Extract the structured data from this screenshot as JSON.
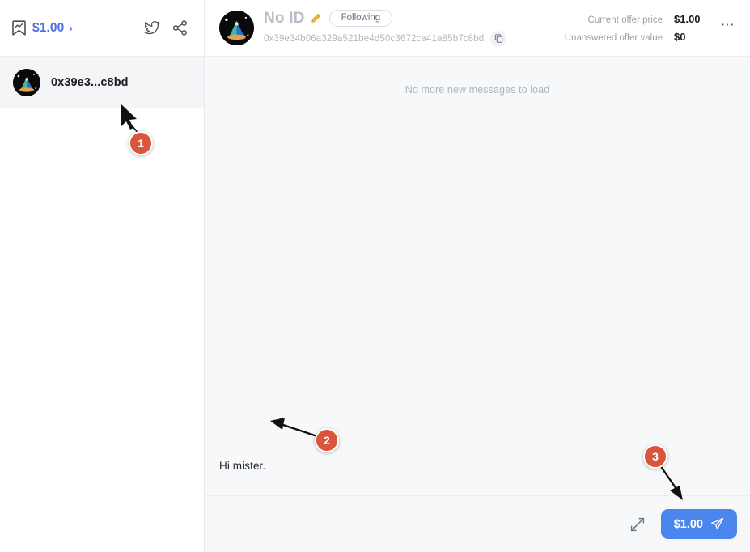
{
  "sidebar": {
    "topbar": {
      "bookmark_icon": "bookmark-chart-icon",
      "price_label": "$1.00",
      "chevron": "›",
      "twitter_icon": "twitter-icon",
      "share_icon": "share-icon"
    },
    "conversations": [
      {
        "name": "0x39e3...c8bd",
        "avatar": "nft-avatar"
      }
    ]
  },
  "header": {
    "avatar": "nft-avatar",
    "title": "No ID",
    "edit_icon": "pencil-icon",
    "following_label": "Following",
    "address": "0x39e34b06a329a521be4d50c3672ca41a85b7c8bd",
    "copy_icon": "copy-icon",
    "more_icon": "more-horizontal-icon",
    "offers": [
      {
        "label": "Current offer price",
        "value": "$1.00"
      },
      {
        "label": "Unanswered offer value",
        "value": "$0"
      }
    ]
  },
  "messages": {
    "no_more_label": "No more new messages to load",
    "items": [
      {
        "text": "Hi mister.",
        "direction": "incoming"
      }
    ]
  },
  "composer": {
    "expand_icon": "expand-icon",
    "send_label": "$1.00",
    "send_icon": "send-plane-icon"
  },
  "annotations": [
    {
      "number": "1",
      "type": "cursor-pointer"
    },
    {
      "number": "2",
      "type": "arrow-left"
    },
    {
      "number": "3",
      "type": "arrow-down-right"
    }
  ],
  "colors": {
    "accent_blue": "#4a86ed",
    "link_blue": "#4a6fe3",
    "marker_orange": "#d9563c",
    "background": "#f7f8fa",
    "panel": "#ffffff"
  }
}
